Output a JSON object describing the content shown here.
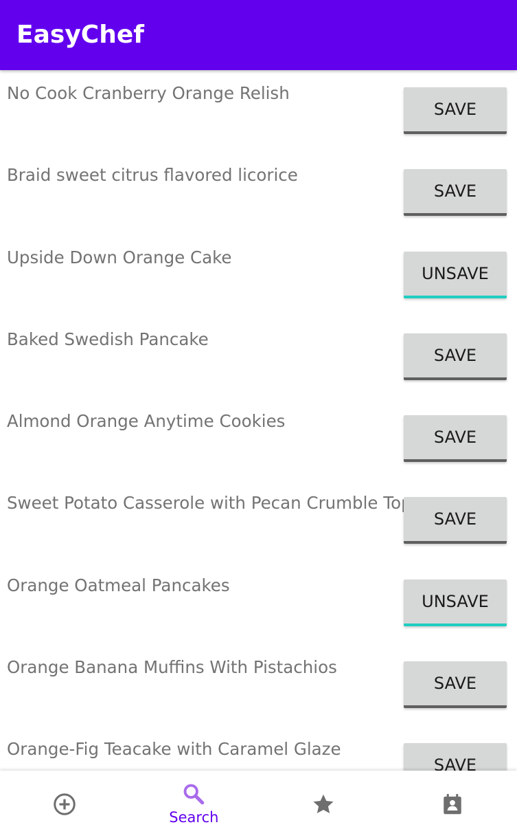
{
  "app_bar": {
    "title": "EasyChef"
  },
  "recipes": [
    {
      "title": "No Cook Cranberry Orange Relish",
      "button": "SAVE",
      "saved": false
    },
    {
      "title": "Braid sweet citrus flavored licorice",
      "button": "SAVE",
      "saved": false
    },
    {
      "title": "Upside Down Orange Cake",
      "button": "UNSAVE",
      "saved": true
    },
    {
      "title": "Baked Swedish Pancake",
      "button": "SAVE",
      "saved": false
    },
    {
      "title": "Almond Orange Anytime Cookies",
      "button": "SAVE",
      "saved": false
    },
    {
      "title": "Sweet Potato Casserole with Pecan Crumble Topping",
      "button": "SAVE",
      "saved": false
    },
    {
      "title": "Orange Oatmeal Pancakes",
      "button": "UNSAVE",
      "saved": true
    },
    {
      "title": "Orange Banana Muffins With Pistachios",
      "button": "SAVE",
      "saved": false
    },
    {
      "title": "Orange-Fig Teacake with Caramel Glaze",
      "button": "SAVE",
      "saved": false
    }
  ],
  "bottom_nav": {
    "items": [
      {
        "icon": "add-circle-icon",
        "label": "",
        "active": false
      },
      {
        "icon": "search-icon",
        "label": "Search",
        "active": true
      },
      {
        "icon": "star-icon",
        "label": "",
        "active": false
      },
      {
        "icon": "profile-card-icon",
        "label": "",
        "active": false
      }
    ]
  },
  "colors": {
    "primary": "#6200EE",
    "saved_accent": "#21CDC0",
    "inactive_icon": "#6E6E6E",
    "active_icon": "#A96BEB"
  }
}
